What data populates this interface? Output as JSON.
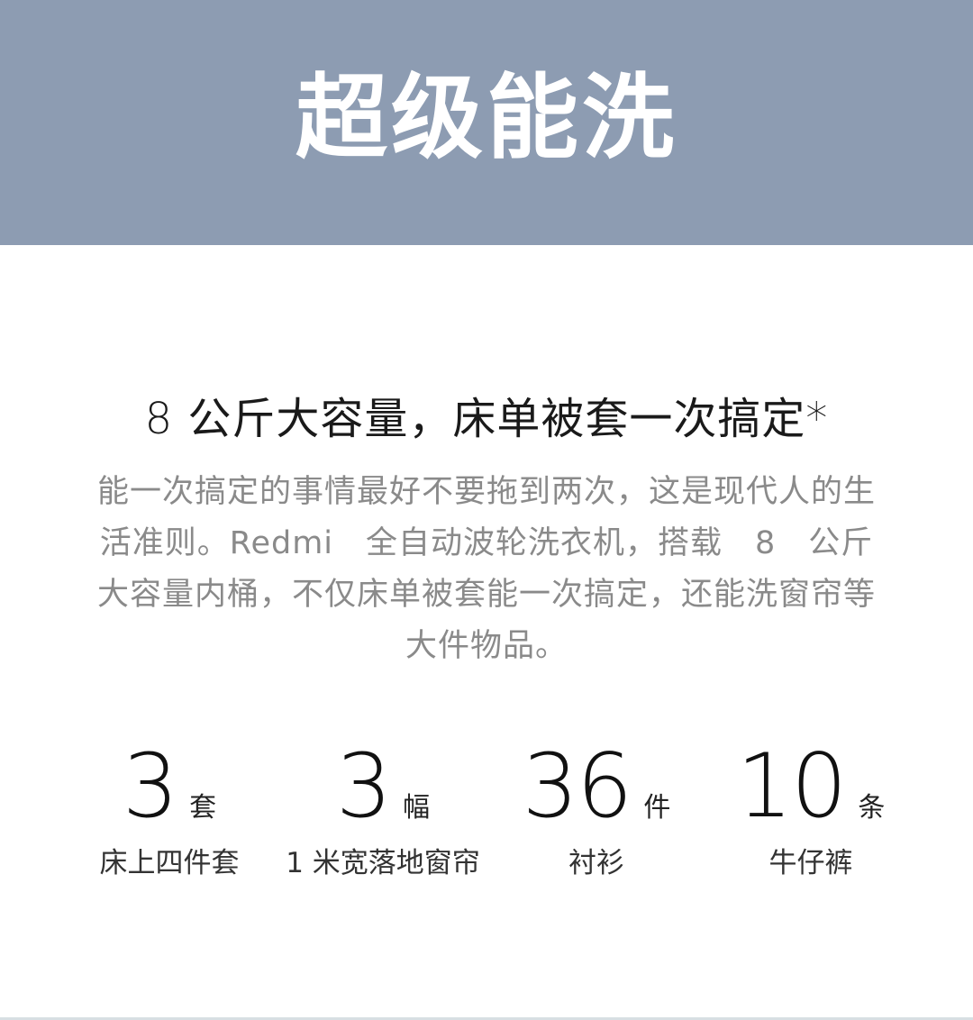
{
  "banner": {
    "title": "超级能洗"
  },
  "section": {
    "headline": "8 公斤大容量，床单被套一次搞定*",
    "body": "能一次搞定的事情最好不要拖到两次，这是现代人的生活准则。Redmi　全自动波轮洗衣机，搭载　8　公斤大容量内桶，不仅床单被套能一次搞定，还能洗窗帘等大件物品。"
  },
  "stats": [
    {
      "number": "3",
      "unit": "套",
      "label": "床上四件套"
    },
    {
      "number": "3",
      "unit": "幅",
      "label": "1 米宽落地窗帘"
    },
    {
      "number": "36",
      "unit": "件",
      "label": "衬衫"
    },
    {
      "number": "10",
      "unit": "条",
      "label": "牛仔裤"
    }
  ],
  "colors": {
    "banner_background": "#8d9cb2",
    "body_text": "#8a8a8a"
  }
}
